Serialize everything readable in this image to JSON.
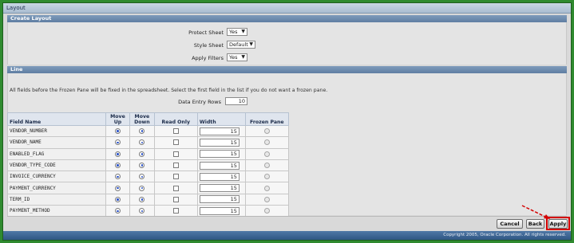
{
  "window": {
    "title": "Layout"
  },
  "create_layout": {
    "title": "Create Layout",
    "protect_sheet": {
      "label": "Protect Sheet",
      "value": "Yes"
    },
    "style_sheet": {
      "label": "Style Sheet",
      "value": "Default"
    },
    "apply_filters": {
      "label": "Apply Filters",
      "value": "Yes"
    }
  },
  "line": {
    "title": "Line",
    "instruction": "All fields before the Frozen Pane will be fixed in the spreadsheet. Select the first field in the list if you do not want a frozen pane.",
    "data_entry_rows": {
      "label": "Data Entry Rows",
      "value": "10"
    },
    "columns": [
      "Field Name",
      "Move Up",
      "Move Down",
      "Read Only",
      "Width",
      "Frozen Pane"
    ],
    "rows": [
      {
        "field": "VENDOR_NUMBER",
        "width": "15"
      },
      {
        "field": "VENDOR_NAME",
        "width": "15"
      },
      {
        "field": "ENABLED_FLAG",
        "width": "15"
      },
      {
        "field": "VENDOR_TYPE_CODE",
        "width": "15"
      },
      {
        "field": "INVOICE_CURRENCY",
        "width": "15"
      },
      {
        "field": "PAYMENT_CURRENCY",
        "width": "15"
      },
      {
        "field": "TERM_ID",
        "width": "15"
      },
      {
        "field": "PAYMENT_METHOD",
        "width": "15"
      }
    ]
  },
  "buttons": {
    "cancel": "Cancel",
    "back": "Back",
    "apply": "Apply"
  },
  "footer": {
    "copyright": "Copyright 2005, Oracle Corporation. All rights reserved."
  },
  "colors": {
    "frame_green": "#2f8a2f",
    "section_bar": "#6f8db0",
    "highlight_red": "#d40000"
  }
}
